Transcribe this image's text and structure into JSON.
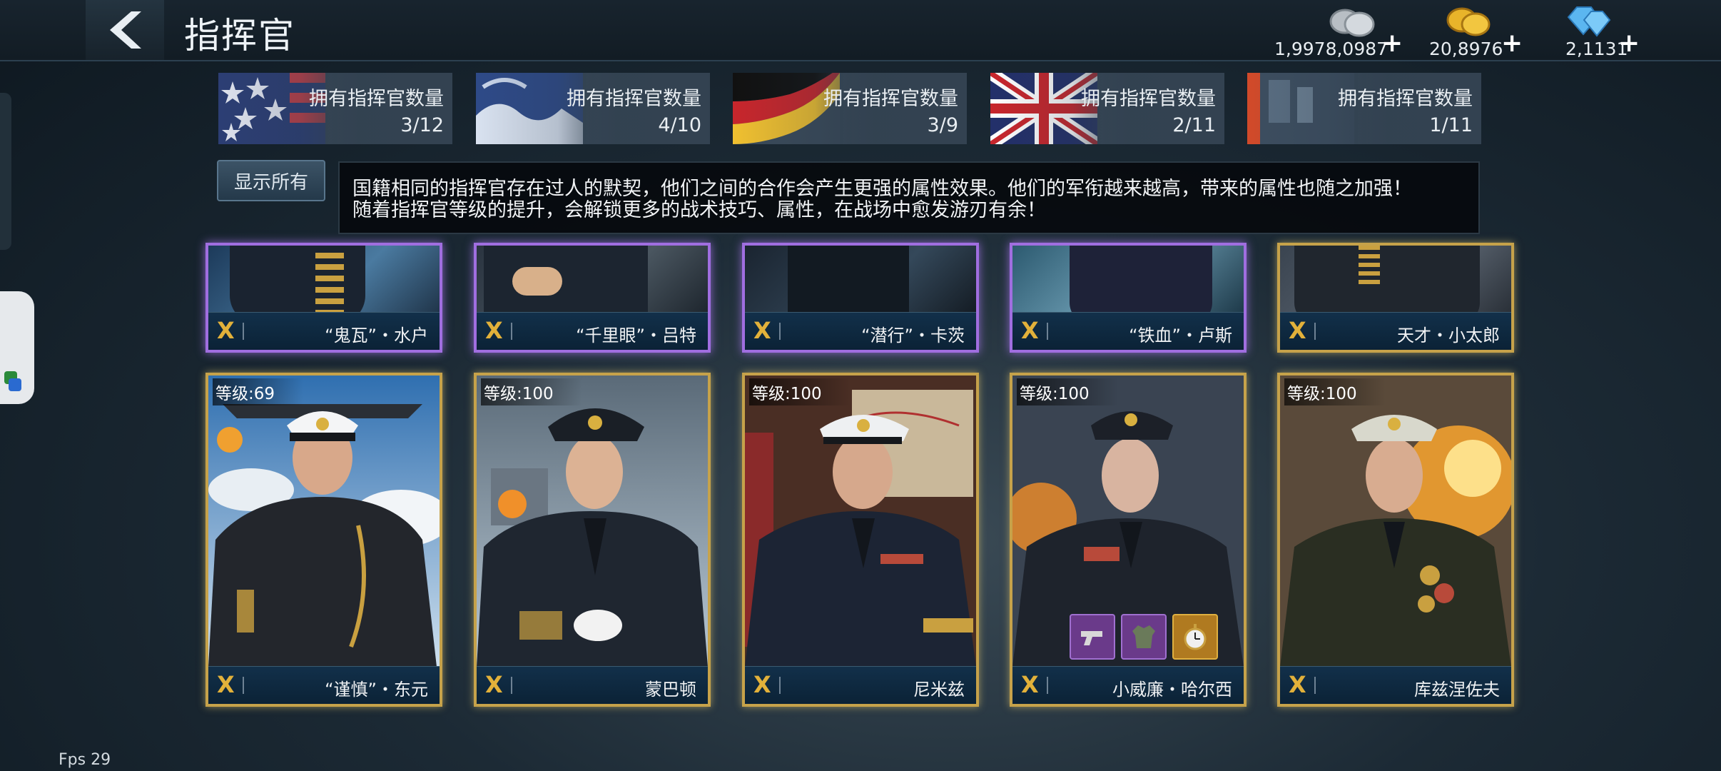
{
  "header": {
    "title": "指挥官",
    "currencies": [
      {
        "icon": "silver-coins-icon",
        "amount": "1,9978,0987",
        "plus": "+"
      },
      {
        "icon": "gold-coins-icon",
        "amount": "20,8976",
        "plus": "+"
      },
      {
        "icon": "diamond-gems-icon",
        "amount": "2,1131",
        "plus": "+"
      }
    ]
  },
  "nations": [
    {
      "flag": "usa-flag",
      "label": "拥有指挥官数量",
      "count": "3/12"
    },
    {
      "flag": "japan-flag",
      "label": "拥有指挥官数量",
      "count": "4/10"
    },
    {
      "flag": "germany-flag",
      "label": "拥有指挥官数量",
      "count": "3/9"
    },
    {
      "flag": "uk-flag",
      "label": "拥有指挥官数量",
      "count": "2/11"
    },
    {
      "flag": "ussr-flag",
      "label": "拥有指挥官数量",
      "count": "1/11"
    }
  ],
  "filter": {
    "show_all": "显示所有"
  },
  "tooltip": {
    "line1": "国籍相同的指挥官存在过人的默契，他们之间的合作会产生更强的属性效果。他们的军衔越来越高，带来的属性也随之加强！",
    "line2": "随着指挥官等级的提升，会解锁更多的战术技巧、属性，在战场中愈发游刃有余！"
  },
  "row1": [
    {
      "mark": "X",
      "name": "“鬼瓦”・水户",
      "rarity": "purple"
    },
    {
      "mark": "X",
      "name": "“千里眼”・吕特",
      "rarity": "purple"
    },
    {
      "mark": "X",
      "name": "“潜行”・卡茨",
      "rarity": "purple"
    },
    {
      "mark": "X",
      "name": "“铁血”・卢斯",
      "rarity": "purple"
    },
    {
      "mark": "X",
      "name": "天才・小太郎",
      "rarity": "gold"
    }
  ],
  "row2": [
    {
      "mark": "X",
      "level": "等级:69",
      "name": "“谨慎”・东元"
    },
    {
      "mark": "X",
      "level": "等级:100",
      "name": "蒙巴顿"
    },
    {
      "mark": "X",
      "level": "等级:100",
      "name": "尼米兹"
    },
    {
      "mark": "X",
      "level": "等级:100",
      "name": "小威廉・哈尔西",
      "items": [
        "pistol-icon",
        "uniform-icon",
        "pocket-watch-icon"
      ]
    },
    {
      "mark": "X",
      "level": "等级:100",
      "name": "库兹涅佐夫"
    }
  ],
  "status": {
    "fps": "Fps 29"
  }
}
